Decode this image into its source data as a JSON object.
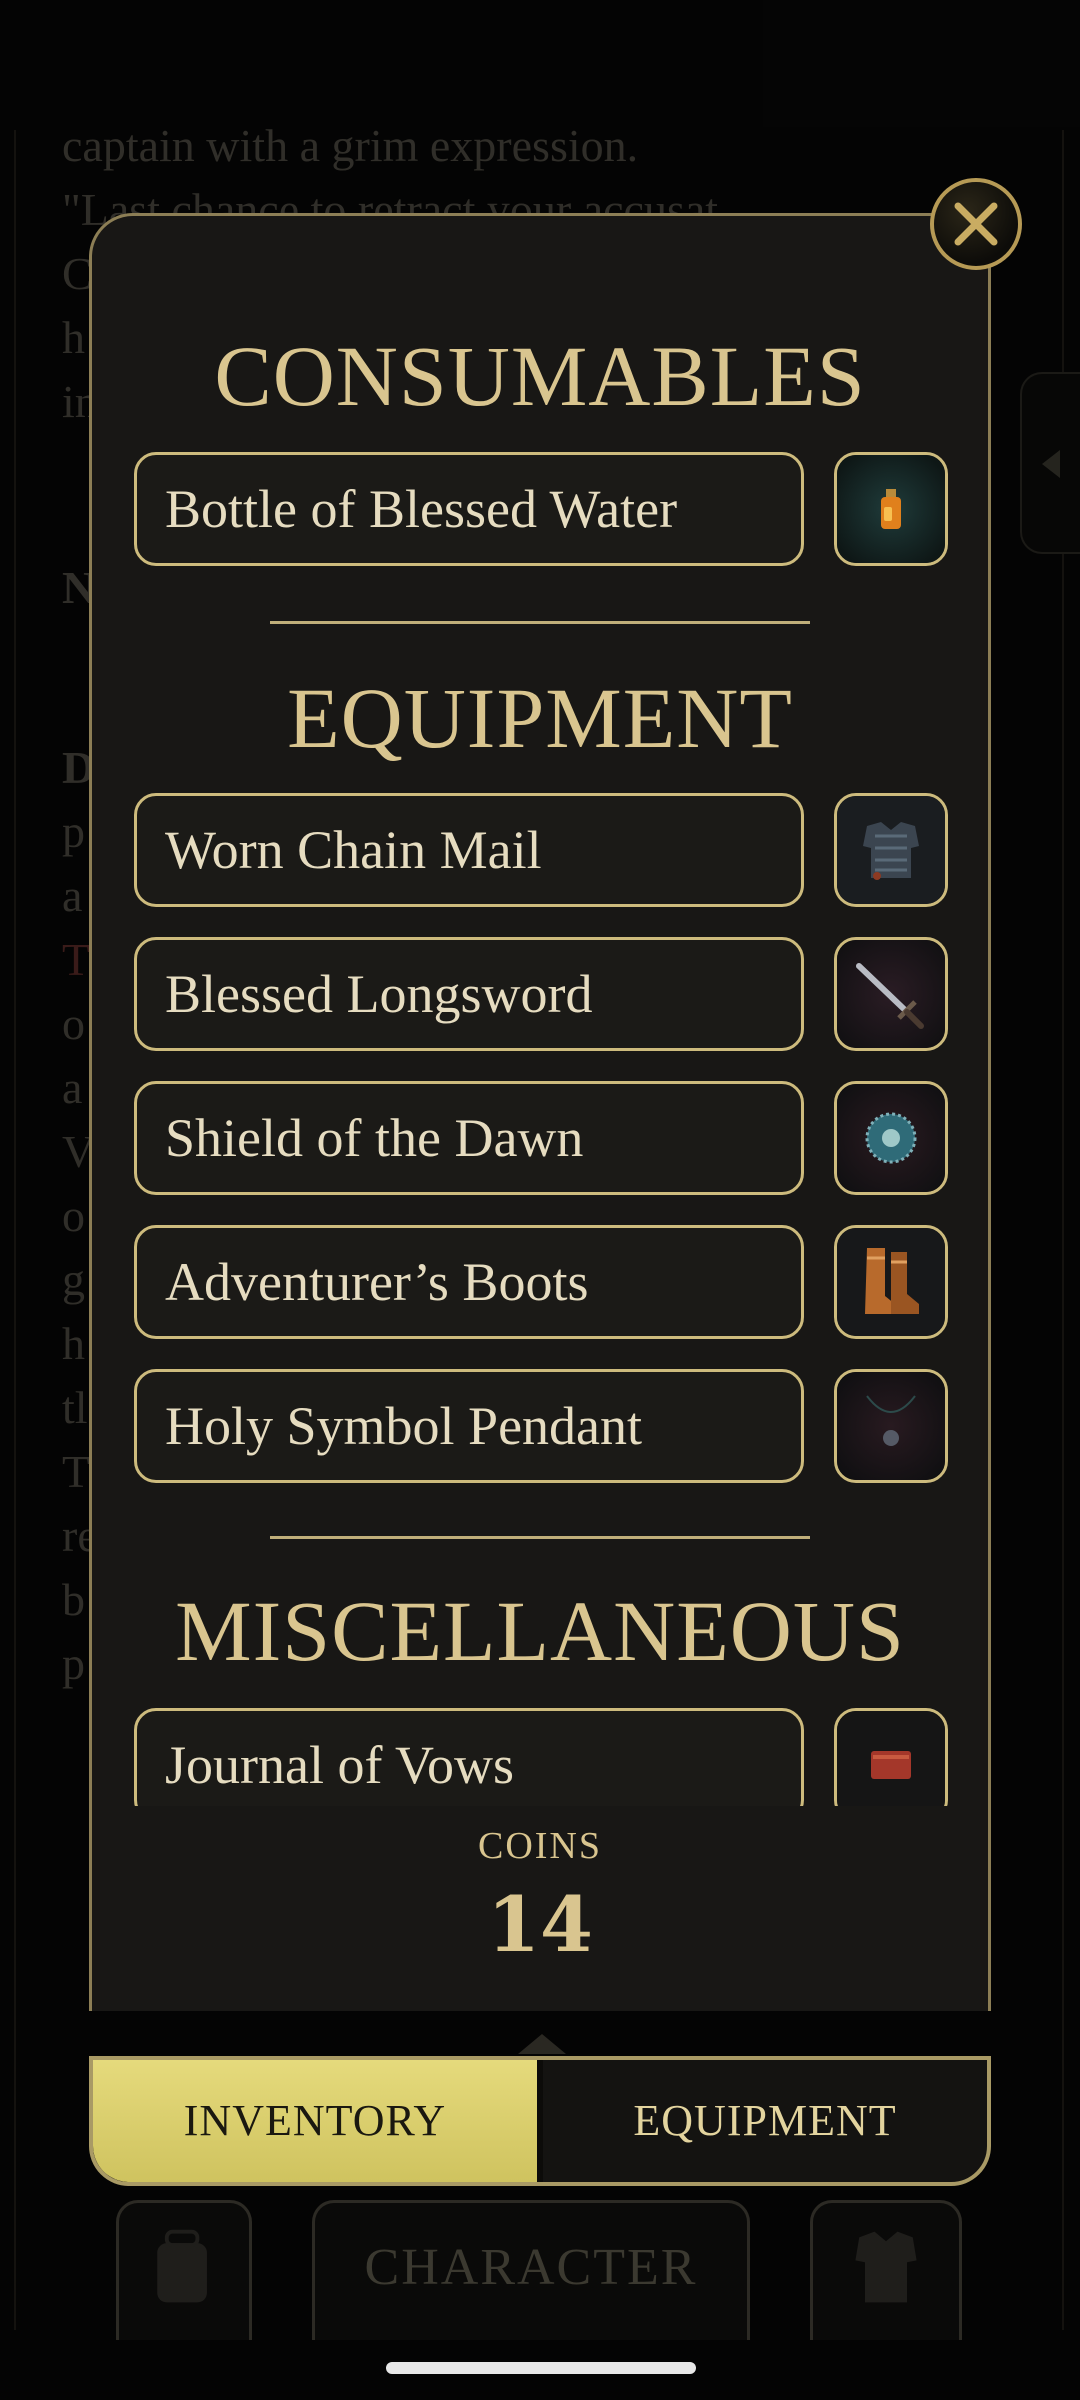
{
  "background_story": {
    "lines": [
      "captain with a grim expression.",
      "\"Last chance to retract your accusat",
      "C",
      "h",
      "in",
      "N",
      "D",
      "p",
      "a",
      "T",
      "o",
      "a",
      "V",
      "o",
      "g",
      "h",
      "tl",
      "T",
      "re",
      "b",
      "p"
    ]
  },
  "modal": {
    "close_label": "×",
    "sections": {
      "consumables": {
        "title": "CONSUMABLES",
        "items": [
          {
            "label": "Bottle of Blessed Water",
            "icon": "potion-bottle-icon"
          }
        ]
      },
      "equipment": {
        "title": "EQUIPMENT",
        "items": [
          {
            "label": "Worn Chain Mail",
            "icon": "chain-mail-icon"
          },
          {
            "label": "Blessed Longsword",
            "icon": "longsword-icon"
          },
          {
            "label": "Shield of the Dawn",
            "icon": "round-shield-icon"
          },
          {
            "label": "Adventurer’s Boots",
            "icon": "boots-icon"
          },
          {
            "label": "Holy Symbol Pendant",
            "icon": "pendant-icon"
          }
        ]
      },
      "miscellaneous": {
        "title": "MISCELLANEOUS",
        "items": [
          {
            "label": "Journal of Vows",
            "icon": "journal-icon"
          }
        ]
      }
    },
    "coins": {
      "label": "COINS",
      "value": "14"
    }
  },
  "tabs": {
    "inventory": "INVENTORY",
    "equipment": "EQUIPMENT",
    "active": "inventory"
  },
  "bottom_nav": {
    "backpack_icon": "backpack-icon",
    "character_label": "CHARACTER",
    "armor_icon": "armor-icon"
  },
  "colors": {
    "gold_text": "#d9c58f",
    "panel_bg": "#181715",
    "active_tab": "#e5da7c"
  }
}
